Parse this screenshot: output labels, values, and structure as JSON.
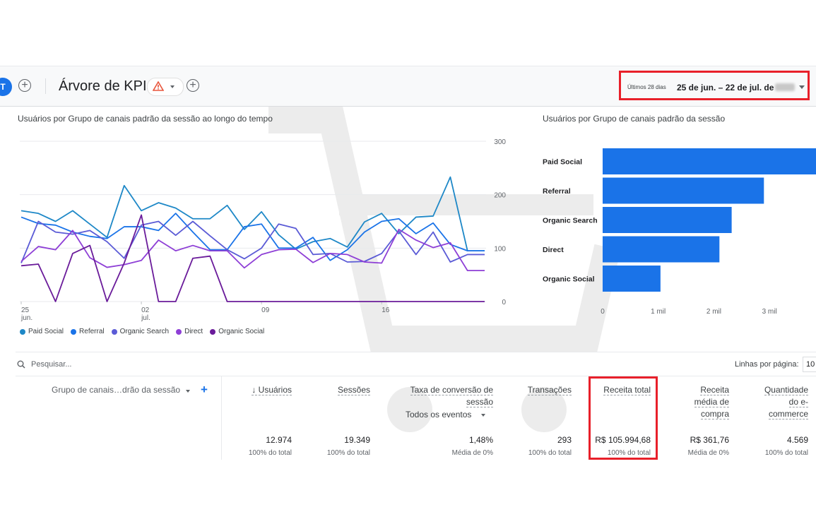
{
  "header": {
    "avatar_letter": "T",
    "title": "Árvore de KPIs",
    "date_label": "Últimos 28 dias",
    "date_range": "25 de jun. – 22 de jul. de"
  },
  "line_card": {
    "title": "Usuários por Grupo de canais padrão da sessão ao longo do tempo"
  },
  "bar_card": {
    "title": "Usuários por Grupo de canais padrão da sessão"
  },
  "colors": {
    "paid_social": "#1e88c7",
    "referral": "#1a73e8",
    "organic_search": "#5b5bd6",
    "direct": "#8e3fd6",
    "organic_social": "#6a1b9a"
  },
  "chart_data": [
    {
      "type": "line",
      "title": "Usuários por Grupo de canais padrão da sessão ao longo do tempo",
      "x_tick_labels": [
        {
          "day": 0,
          "line1": "25",
          "line2": "jun."
        },
        {
          "day": 7,
          "line1": "02",
          "line2": "jul."
        },
        {
          "day": 14,
          "line1": "09",
          "line2": ""
        },
        {
          "day": 21,
          "line1": "16",
          "line2": ""
        }
      ],
      "y_ticks": [
        300,
        200,
        100,
        0
      ],
      "ylim": [
        0,
        300
      ],
      "legend": "bottom",
      "grid": true,
      "x": [
        0,
        1,
        2,
        3,
        4,
        5,
        6,
        7,
        8,
        9,
        10,
        11,
        12,
        13,
        14,
        15,
        16,
        17,
        18,
        19,
        20,
        21,
        22,
        23,
        24,
        25,
        26,
        27
      ],
      "series": [
        {
          "name": "Paid Social",
          "color": "#1e88c7",
          "values": [
            170,
            165,
            150,
            170,
            145,
            120,
            217,
            170,
            185,
            175,
            155,
            155,
            180,
            135,
            168,
            125,
            98,
            112,
            118,
            102,
            149,
            165,
            127,
            158,
            160,
            233,
            95,
            95
          ]
        },
        {
          "name": "Referral",
          "color": "#1a73e8",
          "values": [
            158,
            146,
            143,
            130,
            122,
            118,
            140,
            140,
            133,
            165,
            130,
            97,
            97,
            140,
            145,
            100,
            100,
            120,
            77,
            97,
            130,
            150,
            155,
            127,
            147,
            107,
            95,
            95
          ]
        },
        {
          "name": "Organic Search",
          "color": "#5b5bd6",
          "values": [
            72,
            150,
            130,
            126,
            133,
            112,
            81,
            143,
            150,
            124,
            150,
            123,
            97,
            80,
            100,
            145,
            137,
            88,
            90,
            74,
            75,
            90,
            132,
            88,
            130,
            74,
            88,
            88
          ]
        },
        {
          "name": "Direct",
          "color": "#8e3fd6",
          "values": [
            75,
            103,
            97,
            133,
            82,
            64,
            69,
            77,
            115,
            95,
            105,
            95,
            95,
            63,
            88,
            97,
            98,
            73,
            90,
            88,
            74,
            72,
            135,
            115,
            101,
            110,
            58,
            58
          ]
        },
        {
          "name": "Organic Social",
          "color": "#6a1b9a",
          "values": [
            67,
            70,
            0,
            90,
            105,
            0,
            72,
            162,
            0,
            0,
            81,
            85,
            0,
            0,
            0,
            0,
            0,
            0,
            0,
            0,
            0,
            0,
            0,
            0,
            0,
            0,
            0,
            0
          ]
        }
      ]
    },
    {
      "type": "bar",
      "orientation": "horizontal",
      "title": "Usuários por Grupo de canais padrão da sessão",
      "categories": [
        "Paid Social",
        "Referral",
        "Organic Search",
        "Direct",
        "Organic Social"
      ],
      "values": [
        3950,
        2900,
        2320,
        2100,
        1040
      ],
      "x_ticks": [
        {
          "v": 0,
          "label": "0"
        },
        {
          "v": 1000,
          "label": "1 mil"
        },
        {
          "v": 2000,
          "label": "2 mil"
        },
        {
          "v": 3000,
          "label": "3 mil"
        }
      ],
      "xlim": [
        0,
        3900
      ],
      "color": "#1a73e8"
    }
  ],
  "table": {
    "search_placeholder": "Pesquisar...",
    "rows_per_page_label": "Linhas por página:",
    "rows_per_page_value": "10",
    "dimension_header": "Grupo de canais…drão da sessão",
    "events_filter": "Todos os eventos",
    "columns": [
      {
        "key": "users",
        "lines": [
          "↓ Usuários"
        ],
        "value": "12.974",
        "sub": "100% do total"
      },
      {
        "key": "sessions",
        "lines": [
          "Sessões"
        ],
        "value": "19.349",
        "sub": "100% do total"
      },
      {
        "key": "conv",
        "lines": [
          "Taxa de conversão de",
          "sessão"
        ],
        "value": "1,48%",
        "sub": "Média de 0%"
      },
      {
        "key": "trans",
        "lines": [
          "Transações"
        ],
        "value": "293",
        "sub": "100% do total"
      },
      {
        "key": "revenue",
        "lines": [
          "Receita total"
        ],
        "value": "R$ 105.994,68",
        "sub": "100% do total"
      },
      {
        "key": "avg",
        "lines": [
          "Receita",
          "média de",
          "compra"
        ],
        "value": "R$ 361,76",
        "sub": "Média de 0%"
      },
      {
        "key": "qty",
        "lines": [
          "Quantidade",
          "do e-",
          "commerce"
        ],
        "value": "4.569",
        "sub": "100% do total"
      }
    ]
  }
}
